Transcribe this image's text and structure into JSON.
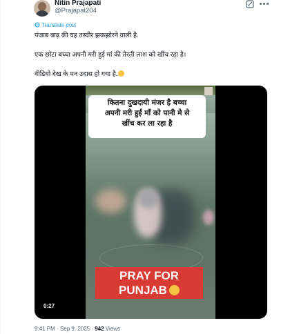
{
  "author": {
    "name": "Nitin Prajapati",
    "handle": "@Prajapat204"
  },
  "translate_label": "Translate post",
  "post": {
    "line1": "पंजाब बाढ़ की यह तस्वीर झकझोरने वाली है.",
    "line2": "एक छोटा बच्चा अपनी मरी हुई मां की तैरती लाश को खींच रहा है।",
    "line3": "वीडियो देख के मन उदास हो गया है."
  },
  "video": {
    "caption_lines": [
      "कितना दुखदायी मंजर है बच्चा",
      "अपनी मरी हुई माँ को पानी मे से",
      "खींच कर ला रहा है"
    ],
    "banner_line1": "PRAY FOR",
    "banner_line2": "PUNJAB",
    "duration": "0:27"
  },
  "meta": {
    "time": "9:41 PM",
    "separator": "·",
    "date": "Sep 9, 2025",
    "views_count": "942",
    "views_label": "Views"
  },
  "icons": {
    "grok": "grok-icon",
    "more": "more-icon",
    "translate": "translate-icon",
    "emoji": "sad-face-emoji"
  },
  "colors": {
    "link": "#1d9bf0",
    "secondary": "#536471",
    "banner": "#d83a34"
  }
}
